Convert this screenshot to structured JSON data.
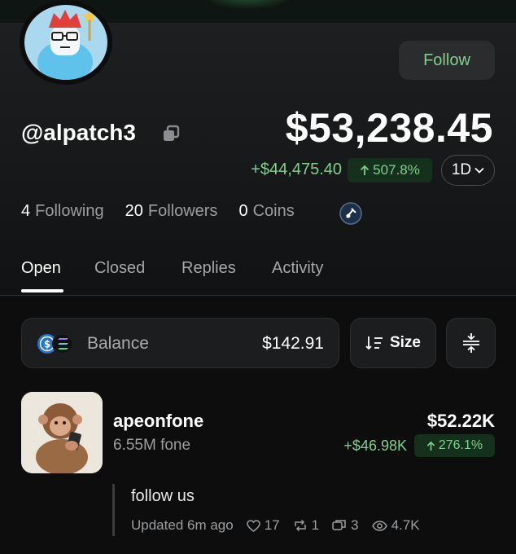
{
  "profile": {
    "username": "@alpatch3",
    "follow_label": "Follow",
    "balance": "$53,238.45",
    "change_amount": "+$44,475.40",
    "change_percent": "507.8%",
    "period": "1D",
    "stats": {
      "following_count": "4",
      "following_label": "Following",
      "followers_count": "20",
      "followers_label": "Followers",
      "coins_count": "0",
      "coins_label": "Coins"
    }
  },
  "tabs": [
    {
      "label": "Open",
      "active": true
    },
    {
      "label": "Closed",
      "active": false
    },
    {
      "label": "Replies",
      "active": false
    },
    {
      "label": "Activity",
      "active": false
    }
  ],
  "toolbar": {
    "balance_label": "Balance",
    "balance_value": "$142.91",
    "sort_label": "Size"
  },
  "position": {
    "name": "apeonfone",
    "holding": "6.55M fone",
    "value": "$52.22K",
    "change_amount": "+$46.98K",
    "change_percent": "276.1%"
  },
  "comment": {
    "text": "follow us",
    "updated": "Updated 6m ago",
    "likes": "17",
    "reposts": "1",
    "replies": "3",
    "views": "4.7K"
  },
  "colors": {
    "accent_green": "#7fd18f",
    "badge_bg": "#16301e",
    "background": "#0d0d0e"
  },
  "icons": [
    "copy-icon",
    "arrow-up-icon",
    "chevron-down-icon",
    "tag-icon",
    "usdc-icon",
    "solana-icon",
    "sort-icon",
    "filter-icon",
    "heart-icon",
    "repost-icon",
    "reply-icon",
    "eye-icon"
  ]
}
